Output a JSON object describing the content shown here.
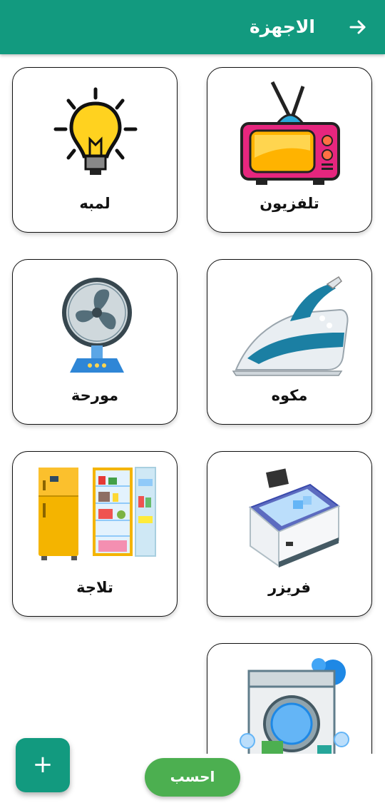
{
  "appbar": {
    "title": "الاجهزة",
    "back_icon": "arrow-forward-icon",
    "color": "#129a7f"
  },
  "devices": [
    {
      "label": "تلفزيون",
      "icon": "television-icon"
    },
    {
      "label": "لمبه",
      "icon": "light-bulb-icon"
    },
    {
      "label": "مكوه",
      "icon": "iron-icon"
    },
    {
      "label": "مورحة",
      "icon": "fan-icon"
    },
    {
      "label": "فريزر",
      "icon": "freezer-icon"
    },
    {
      "label": "تلاجة",
      "icon": "refrigerator-icon"
    },
    {
      "label": "",
      "icon": "washing-machine-icon"
    }
  ],
  "fab": {
    "label": "+",
    "icon": "add-icon"
  },
  "calculate_button": {
    "label": "احسب",
    "color": "#4caf50"
  }
}
